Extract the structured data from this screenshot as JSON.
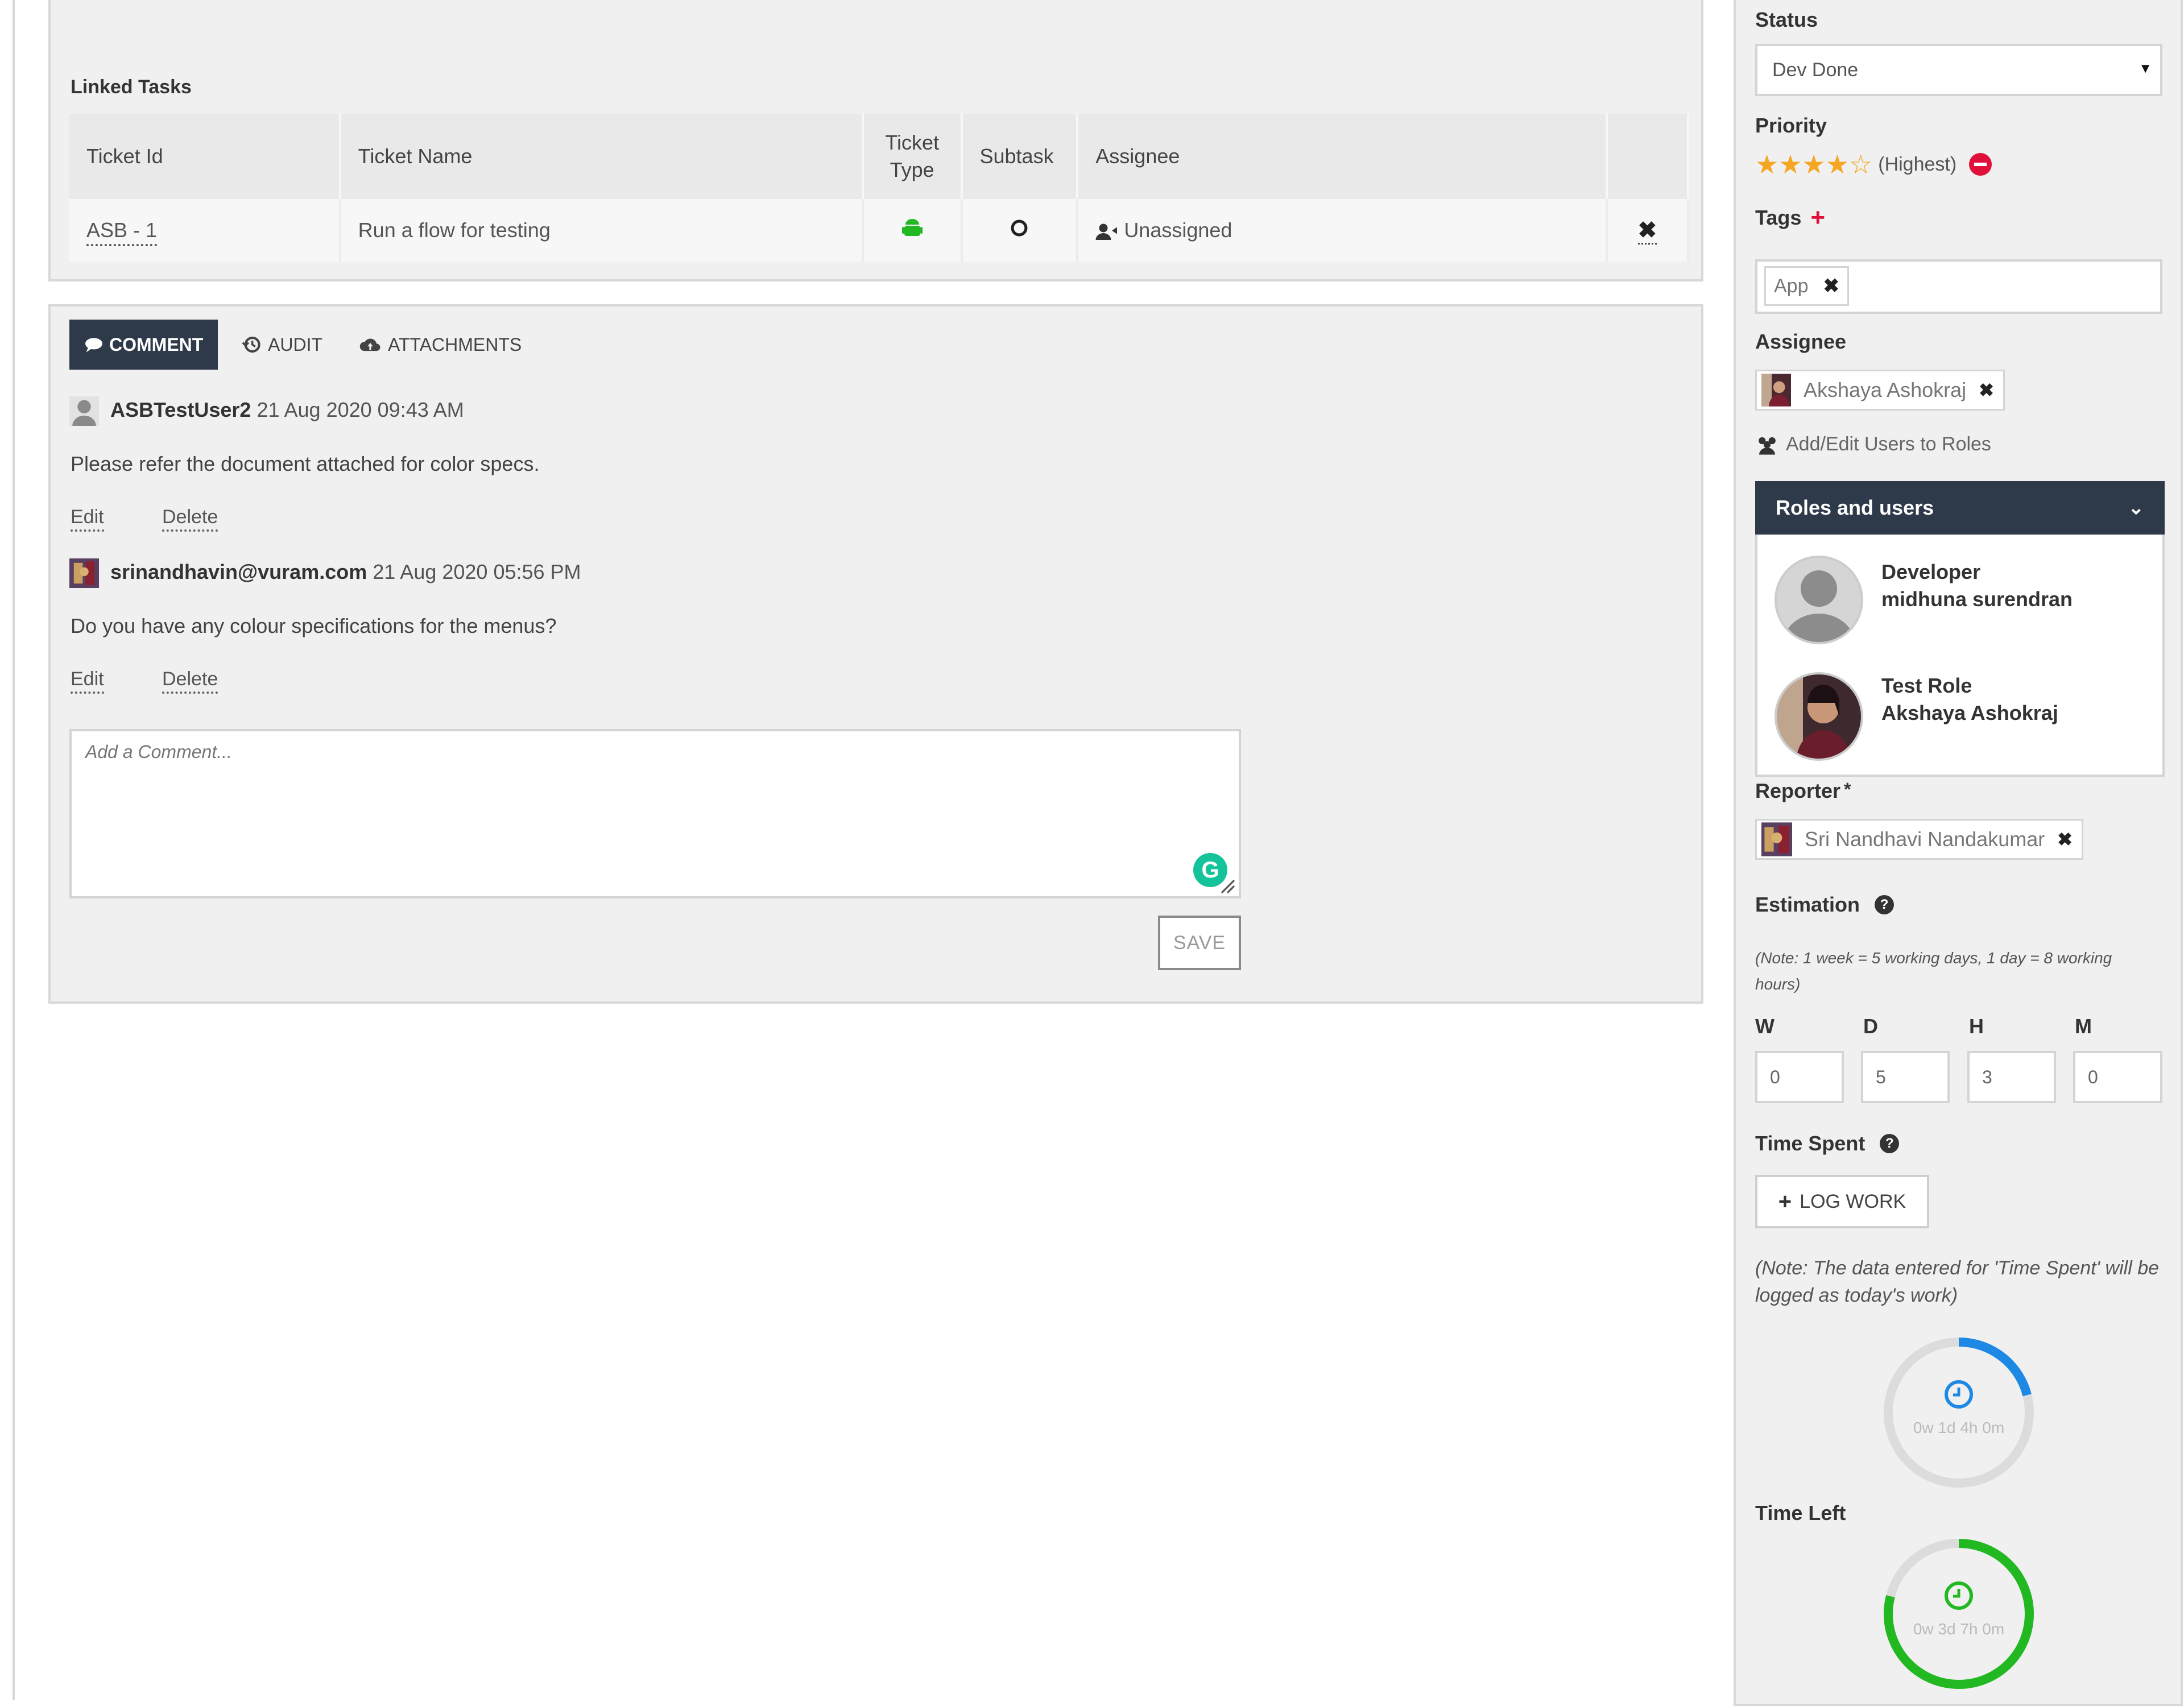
{
  "linked_tasks": {
    "title": "Linked Tasks",
    "columns": [
      "Ticket Id",
      "Ticket Name",
      "Ticket Type",
      "Subtask",
      "Assignee"
    ],
    "ticket_type_header": [
      "Ticket",
      "Type"
    ],
    "rows": [
      {
        "ticket_id": "ASB - 1",
        "ticket_name": "Run a flow for testing",
        "assignee": "Unassigned",
        "type_icon": "android-icon",
        "subtask_icon": "circle-icon"
      }
    ]
  },
  "comment_tabs": [
    "COMMENT",
    "AUDIT",
    "ATTACHMENTS"
  ],
  "comments": [
    {
      "user": "ASBTestUser2",
      "time": "21 Aug 2020 09:43 AM",
      "text": "Please refer the document attached for color specs.",
      "edit": "Edit",
      "delete": "Delete"
    },
    {
      "user": "srinandhavin@vuram.com",
      "time": "21 Aug 2020 05:56 PM",
      "text": "Do you have any colour specifications for the menus?",
      "edit": "Edit",
      "delete": "Delete"
    }
  ],
  "comment_box": {
    "placeholder": "Add a Comment...",
    "save_label": "SAVE"
  },
  "sidebar": {
    "status": {
      "label": "Status",
      "value": "Dev Done"
    },
    "priority": {
      "label": "Priority",
      "text": "(Highest)",
      "stars": 4,
      "max_stars": 5
    },
    "tags": {
      "label": "Tags",
      "items": [
        "App"
      ]
    },
    "assignee": {
      "label": "Assignee",
      "name": "Akshaya Ashokraj"
    },
    "add_edit_users": "Add/Edit Users to Roles",
    "roles": {
      "header": "Roles and users",
      "items": [
        {
          "role": "Developer",
          "user": "midhuna surendran"
        },
        {
          "role": "Test Role",
          "user": "Akshaya Ashokraj"
        }
      ]
    },
    "reporter": {
      "label": "Reporter",
      "required_mark": "*",
      "name": "Sri Nandhavi Nandakumar"
    },
    "estimation": {
      "label": "Estimation",
      "note": "(Note: 1 week = 5 working days, 1 day = 8 working hours)",
      "fields": [
        {
          "label": "W",
          "value": "0"
        },
        {
          "label": "D",
          "value": "5"
        },
        {
          "label": "H",
          "value": "3"
        },
        {
          "label": "M",
          "value": "0"
        }
      ]
    },
    "time_spent": {
      "label": "Time Spent",
      "log_work": "LOG WORK",
      "note": "(Note: The data entered for 'Time Spent' will be logged as today's work)",
      "value": "0w 1d 4h 0m",
      "progress": 0.21
    },
    "time_left": {
      "label": "Time Left",
      "value": "0w 3d 7h 0m",
      "progress": 0.79
    },
    "colors": {
      "accent_blue": "#1e88e5",
      "accent_green": "#22b822",
      "dark_header": "#2e3a4a",
      "star": "#f5a623",
      "danger": "#e0103a"
    }
  }
}
